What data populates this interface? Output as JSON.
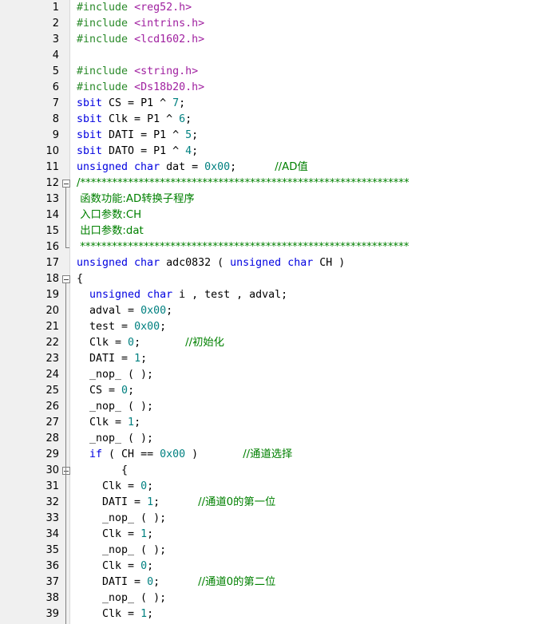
{
  "editor": {
    "colors": {
      "preprocessor": "#2a8a2a",
      "include_path": "#a020a0",
      "keyword": "#0000e0",
      "identifier": "#000000",
      "number": "#008080",
      "comment": "#008000"
    },
    "lines": [
      {
        "n": "1",
        "code": [
          {
            "t": "pp",
            "s": "#include "
          },
          {
            "t": "inc",
            "s": "<reg52.h>"
          }
        ]
      },
      {
        "n": "2",
        "code": [
          {
            "t": "pp",
            "s": "#include "
          },
          {
            "t": "inc",
            "s": "<intrins.h>"
          }
        ]
      },
      {
        "n": "3",
        "code": [
          {
            "t": "pp",
            "s": "#include "
          },
          {
            "t": "inc",
            "s": "<lcd1602.h>"
          }
        ]
      },
      {
        "n": "4",
        "code": []
      },
      {
        "n": "5",
        "code": [
          {
            "t": "pp",
            "s": "#include "
          },
          {
            "t": "inc",
            "s": "<string.h>"
          }
        ]
      },
      {
        "n": "6",
        "code": [
          {
            "t": "pp",
            "s": "#include "
          },
          {
            "t": "inc",
            "s": "<Ds18b20.h>"
          }
        ]
      },
      {
        "n": "7",
        "code": [
          {
            "t": "kw",
            "s": "sbit"
          },
          {
            "t": "id",
            "s": " CS = P1 ^ "
          },
          {
            "t": "num",
            "s": "7"
          },
          {
            "t": "id",
            "s": ";"
          }
        ]
      },
      {
        "n": "8",
        "code": [
          {
            "t": "kw",
            "s": "sbit"
          },
          {
            "t": "id",
            "s": " Clk = P1 ^ "
          },
          {
            "t": "num",
            "s": "6"
          },
          {
            "t": "id",
            "s": ";"
          }
        ]
      },
      {
        "n": "9",
        "code": [
          {
            "t": "kw",
            "s": "sbit"
          },
          {
            "t": "id",
            "s": " DATI = P1 ^ "
          },
          {
            "t": "num",
            "s": "5"
          },
          {
            "t": "id",
            "s": ";"
          }
        ]
      },
      {
        "n": "10",
        "code": [
          {
            "t": "kw",
            "s": "sbit"
          },
          {
            "t": "id",
            "s": " DATO = P1 ^ "
          },
          {
            "t": "num",
            "s": "4"
          },
          {
            "t": "id",
            "s": ";"
          }
        ]
      },
      {
        "n": "11",
        "code": [
          {
            "t": "kw",
            "s": "unsigned char"
          },
          {
            "t": "id",
            "s": " dat = "
          },
          {
            "t": "num",
            "s": "0x00"
          },
          {
            "t": "id",
            "s": ";      "
          },
          {
            "t": "cm",
            "s": "//AD值"
          }
        ]
      },
      {
        "n": "12",
        "fold": "open",
        "code": [
          {
            "t": "cm",
            "s": "/**************************************************************"
          }
        ]
      },
      {
        "n": "13",
        "code": [
          {
            "t": "cm",
            "s": " 函数功能:AD转换子程序"
          }
        ]
      },
      {
        "n": "14",
        "code": [
          {
            "t": "cm",
            "s": " 入口参数:CH"
          }
        ]
      },
      {
        "n": "15",
        "code": [
          {
            "t": "cm",
            "s": " 出口参数:dat"
          }
        ]
      },
      {
        "n": "16",
        "fold": "end",
        "code": [
          {
            "t": "cm",
            "s": " **************************************************************"
          }
        ]
      },
      {
        "n": "17",
        "code": [
          {
            "t": "kw",
            "s": "unsigned char"
          },
          {
            "t": "id",
            "s": " adc0832 ( "
          },
          {
            "t": "kw",
            "s": "unsigned char"
          },
          {
            "t": "id",
            "s": " CH )"
          }
        ]
      },
      {
        "n": "18",
        "fold": "open",
        "code": [
          {
            "t": "id",
            "s": "{"
          }
        ]
      },
      {
        "n": "19",
        "code": [
          {
            "t": "id",
            "s": "  "
          },
          {
            "t": "kw",
            "s": "unsigned char"
          },
          {
            "t": "id",
            "s": " i , test , adval;"
          }
        ]
      },
      {
        "n": "20",
        "code": [
          {
            "t": "id",
            "s": "  adval = "
          },
          {
            "t": "num",
            "s": "0x00"
          },
          {
            "t": "id",
            "s": ";"
          }
        ]
      },
      {
        "n": "21",
        "code": [
          {
            "t": "id",
            "s": "  test = "
          },
          {
            "t": "num",
            "s": "0x00"
          },
          {
            "t": "id",
            "s": ";"
          }
        ]
      },
      {
        "n": "22",
        "code": [
          {
            "t": "id",
            "s": "  Clk = "
          },
          {
            "t": "num",
            "s": "0"
          },
          {
            "t": "id",
            "s": ";       "
          },
          {
            "t": "cm",
            "s": "//初始化"
          }
        ]
      },
      {
        "n": "23",
        "code": [
          {
            "t": "id",
            "s": "  DATI = "
          },
          {
            "t": "num",
            "s": "1"
          },
          {
            "t": "id",
            "s": ";"
          }
        ]
      },
      {
        "n": "24",
        "code": [
          {
            "t": "id",
            "s": "  _nop_ ( );"
          }
        ]
      },
      {
        "n": "25",
        "code": [
          {
            "t": "id",
            "s": "  CS = "
          },
          {
            "t": "num",
            "s": "0"
          },
          {
            "t": "id",
            "s": ";"
          }
        ]
      },
      {
        "n": "26",
        "code": [
          {
            "t": "id",
            "s": "  _nop_ ( );"
          }
        ]
      },
      {
        "n": "27",
        "code": [
          {
            "t": "id",
            "s": "  Clk = "
          },
          {
            "t": "num",
            "s": "1"
          },
          {
            "t": "id",
            "s": ";"
          }
        ]
      },
      {
        "n": "28",
        "code": [
          {
            "t": "id",
            "s": "  _nop_ ( );"
          }
        ]
      },
      {
        "n": "29",
        "code": [
          {
            "t": "id",
            "s": "  "
          },
          {
            "t": "kw",
            "s": "if"
          },
          {
            "t": "id",
            "s": " ( CH == "
          },
          {
            "t": "num",
            "s": "0x00"
          },
          {
            "t": "id",
            "s": " )       "
          },
          {
            "t": "cm",
            "s": "//通道选择"
          }
        ]
      },
      {
        "n": "30",
        "fold": "open",
        "code": [
          {
            "t": "id",
            "s": "       {"
          }
        ]
      },
      {
        "n": "31",
        "code": [
          {
            "t": "id",
            "s": "    Clk = "
          },
          {
            "t": "num",
            "s": "0"
          },
          {
            "t": "id",
            "s": ";"
          }
        ]
      },
      {
        "n": "32",
        "code": [
          {
            "t": "id",
            "s": "    DATI = "
          },
          {
            "t": "num",
            "s": "1"
          },
          {
            "t": "id",
            "s": ";      "
          },
          {
            "t": "cm",
            "s": "//通道0的第一位"
          }
        ]
      },
      {
        "n": "33",
        "code": [
          {
            "t": "id",
            "s": "    _nop_ ( );"
          }
        ]
      },
      {
        "n": "34",
        "code": [
          {
            "t": "id",
            "s": "    Clk = "
          },
          {
            "t": "num",
            "s": "1"
          },
          {
            "t": "id",
            "s": ";"
          }
        ]
      },
      {
        "n": "35",
        "code": [
          {
            "t": "id",
            "s": "    _nop_ ( );"
          }
        ]
      },
      {
        "n": "36",
        "code": [
          {
            "t": "id",
            "s": "    Clk = "
          },
          {
            "t": "num",
            "s": "0"
          },
          {
            "t": "id",
            "s": ";"
          }
        ]
      },
      {
        "n": "37",
        "code": [
          {
            "t": "id",
            "s": "    DATI = "
          },
          {
            "t": "num",
            "s": "0"
          },
          {
            "t": "id",
            "s": ";      "
          },
          {
            "t": "cm",
            "s": "//通道0的第二位"
          }
        ]
      },
      {
        "n": "38",
        "code": [
          {
            "t": "id",
            "s": "    _nop_ ( );"
          }
        ]
      },
      {
        "n": "39",
        "code": [
          {
            "t": "id",
            "s": "    Clk = "
          },
          {
            "t": "num",
            "s": "1"
          },
          {
            "t": "id",
            "s": ";"
          }
        ]
      }
    ]
  }
}
